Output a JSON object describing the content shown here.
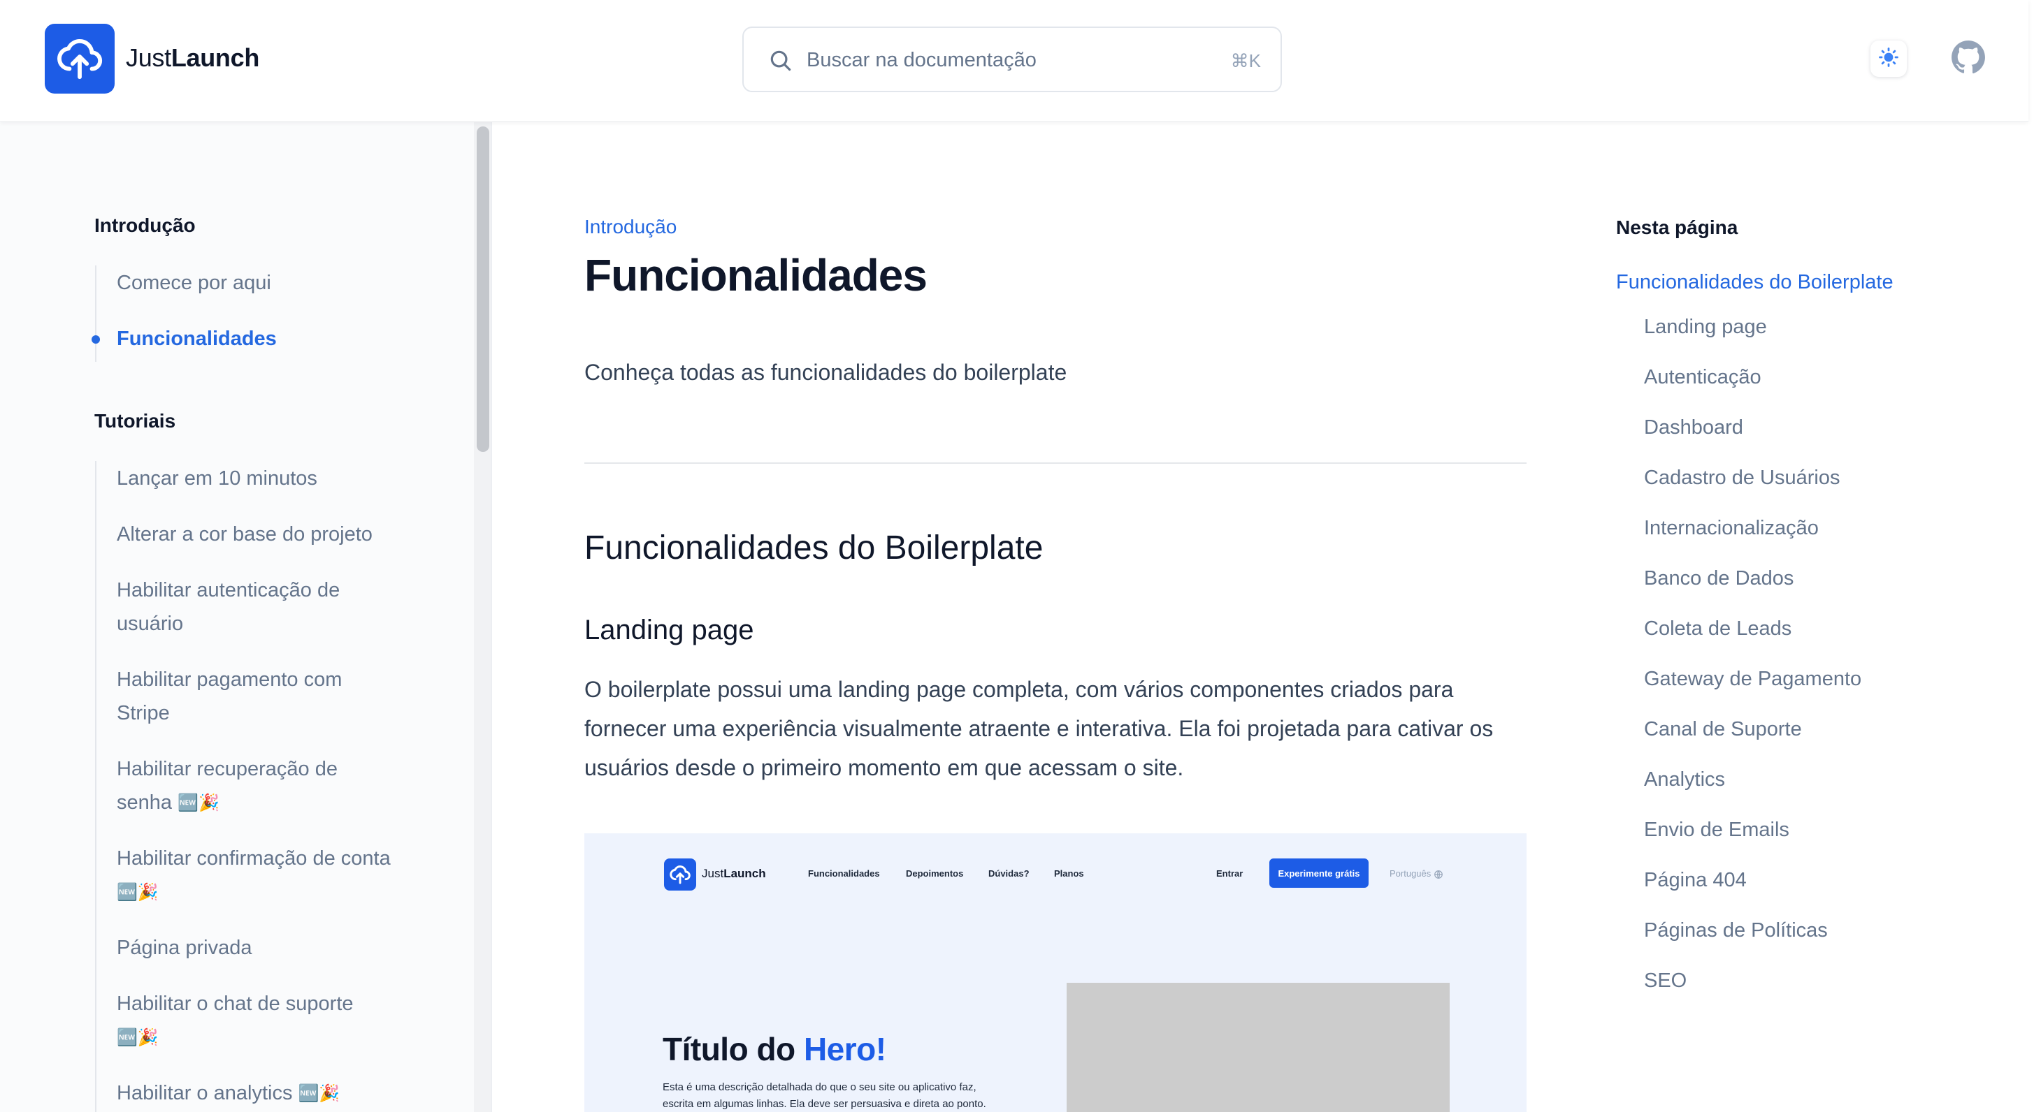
{
  "header": {
    "brand_part1": "Just",
    "brand_part2": "Launch",
    "search_placeholder": "Buscar na documentação",
    "search_shortcut": "⌘K",
    "icons": [
      "upload-cloud-icon",
      "search-icon",
      "sun-icon",
      "github-icon"
    ]
  },
  "sidebar": {
    "sections": [
      {
        "title": "Introdução",
        "items": [
          {
            "label": "Comece por aqui",
            "active": false
          },
          {
            "label": "Funcionalidades",
            "active": true
          }
        ]
      },
      {
        "title": "Tutoriais",
        "items": [
          {
            "label": "Lançar em 10 minutos"
          },
          {
            "label": "Alterar a cor base do projeto"
          },
          {
            "label": "Habilitar autenticação de usuário"
          },
          {
            "label": "Habilitar pagamento com Stripe"
          },
          {
            "label": "Habilitar recuperação de senha",
            "badge": "🆕🎉"
          },
          {
            "label": "Habilitar confirmação de conta",
            "badge": "🆕🎉"
          },
          {
            "label": "Página privada"
          },
          {
            "label": "Habilitar o chat de suporte",
            "badge": "🆕🎉"
          },
          {
            "label": "Habilitar o analytics",
            "badge": "🆕🎉"
          }
        ]
      }
    ]
  },
  "main": {
    "eyebrow": "Introdução",
    "title": "Funcionalidades",
    "lead": "Conheça todas as funcionalidades do boilerplate",
    "h2": "Funcionalidades do Boilerplate",
    "h3": "Landing page",
    "paragraph": "O boilerplate possui uma landing page completa, com vários componentes criados para fornecer uma experiência visualmente atraente e interativa. Ela foi projetada para cativar os usuários desde o primeiro momento em que acessam o site.",
    "preview": {
      "brand_part1": "Just",
      "brand_part2": "Launch",
      "nav": [
        "Funcionalidades",
        "Depoimentos",
        "Dúvidas?",
        "Planos"
      ],
      "login": "Entrar",
      "cta": "Experimente grátis",
      "language": "Português",
      "hero_title_part1": "Título do ",
      "hero_title_highlight": "Hero!",
      "hero_desc": "Esta é uma descrição detalhada do que o seu site ou aplicativo faz, escrita em algumas linhas. Ela deve ser persuasiva e direta ao ponto."
    }
  },
  "toc": {
    "heading": "Nesta página",
    "main": "Funcionalidades do Boilerplate",
    "items": [
      "Landing page",
      "Autenticação",
      "Dashboard",
      "Cadastro de Usuários",
      "Internacionalização",
      "Banco de Dados",
      "Coleta de Leads",
      "Gateway de Pagamento",
      "Canal de Suporte",
      "Analytics",
      "Envio de Emails",
      "Página 404",
      "Páginas de Políticas",
      "SEO"
    ]
  },
  "colors": {
    "accent": "#2468e0",
    "brand": "#1d5ce6",
    "muted_text": "#64748b"
  }
}
